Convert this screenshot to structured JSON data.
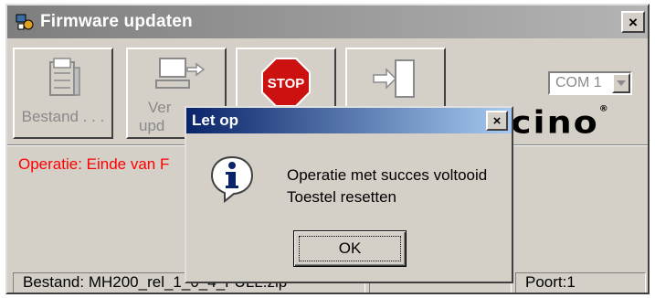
{
  "window": {
    "title": "Firmware updaten",
    "close_label": "×"
  },
  "toolbar": {
    "file_button_label": "Bestand . . .",
    "update_button_line1": "Ver",
    "update_button_line2": "upd",
    "stop_icon_text": "STOP",
    "port_select_value": "COM 1"
  },
  "brand": {
    "text": "icino",
    "mark": "®"
  },
  "operation_text": "Operatie: Einde van F",
  "statusbar": {
    "file_text": "Bestand: MH200_rel_1_0_4_FULL.zip",
    "port_text": "Poort:1"
  },
  "dialog": {
    "title": "Let op",
    "close_label": "×",
    "message_line1": "Operatie met succes voltooid",
    "message_line2": "Toestel resetten",
    "ok_label": "OK"
  },
  "colors": {
    "dialog_title_start": "#0a246a",
    "dialog_title_end": "#a6caf0",
    "operation_text": "#ff0000"
  }
}
